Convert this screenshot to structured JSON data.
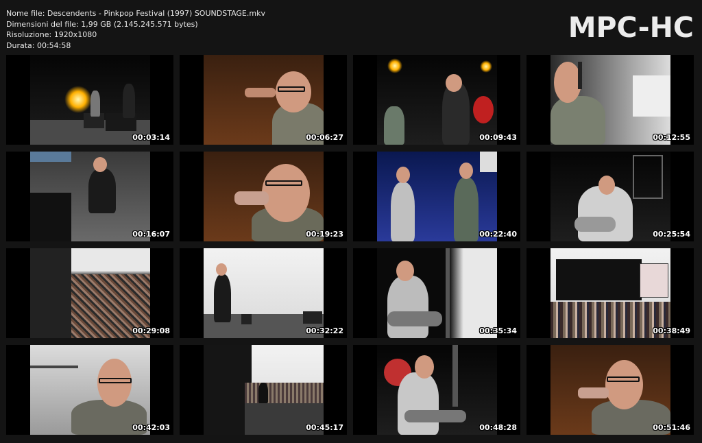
{
  "header": {
    "line1": "Nome file: Descendents - Pinkpop Festival (1997) SOUNDSTAGE.mkv",
    "line2": "Dimensioni del file: 1,99 GB (2.145.245.571 bytes)",
    "line3": "Risoluzione: 1920x1080",
    "line4": "Durata: 00:54:58"
  },
  "logo": "MPC-HC",
  "thumbnails": [
    {
      "time": "00:03:14"
    },
    {
      "time": "00:06:27"
    },
    {
      "time": "00:09:43"
    },
    {
      "time": "00:12:55"
    },
    {
      "time": "00:16:07"
    },
    {
      "time": "00:19:23"
    },
    {
      "time": "00:22:40"
    },
    {
      "time": "00:25:54"
    },
    {
      "time": "00:29:08"
    },
    {
      "time": "00:32:22"
    },
    {
      "time": "00:35:34"
    },
    {
      "time": "00:38:49"
    },
    {
      "time": "00:42:03"
    },
    {
      "time": "00:45:17"
    },
    {
      "time": "00:48:28"
    },
    {
      "time": "00:51:46"
    }
  ]
}
